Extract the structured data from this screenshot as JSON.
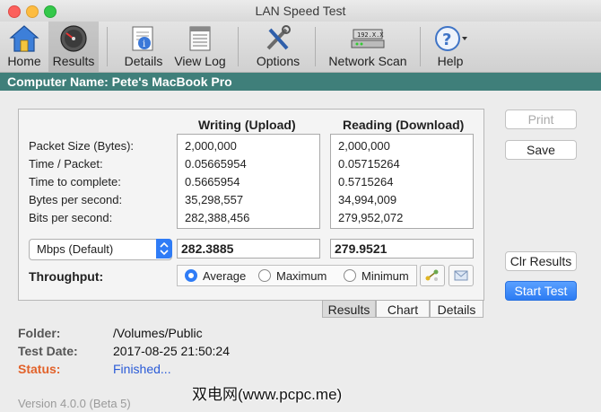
{
  "window": {
    "title": "LAN Speed Test"
  },
  "toolbar": {
    "home": "Home",
    "results": "Results",
    "details": "Details",
    "view_log": "View Log",
    "options": "Options",
    "network_scan": "Network Scan",
    "help": "Help"
  },
  "computer_bar": {
    "text": "Computer Name: Pete's MacBook Pro"
  },
  "results": {
    "writing_header": "Writing (Upload)",
    "reading_header": "Reading (Download)",
    "row_labels": [
      "Packet Size (Bytes):",
      "Time / Packet:",
      "Time to complete:",
      "Bytes per second:",
      "Bits per second:"
    ],
    "writing_values": [
      "2,000,000",
      "0.05665954",
      "0.5665954",
      "35,298,557",
      "282,388,456"
    ],
    "reading_values": [
      "2,000,000",
      "0.05715264",
      "0.5715264",
      "34,994,009",
      "279,952,072"
    ],
    "unit_select": "Mbps (Default)",
    "writing_throughput": "282.3885",
    "reading_throughput": "279.9521",
    "throughput_label": "Throughput:",
    "radio_average": "Average",
    "radio_maximum": "Maximum",
    "radio_minimum": "Minimum"
  },
  "tabs": {
    "results": "Results",
    "chart": "Chart",
    "details": "Details"
  },
  "side_buttons": {
    "print": "Print",
    "save": "Save",
    "clr_results": "Clr Results",
    "start_test": "Start Test"
  },
  "info": {
    "folder_label": "Folder:",
    "folder_value": "/Volumes/Public",
    "date_label": "Test Date:",
    "date_value": "2017-08-25 21:50:24",
    "status_label": "Status:",
    "status_value": "Finished..."
  },
  "version": "Version 4.0.0 (Beta 5)",
  "watermark": "双电网(www.pcpc.me)",
  "colors": {
    "accent": "#2f7cf6",
    "computer_bar": "#3f7f7a",
    "status_label": "#e2622a",
    "status_value": "#2a5bd7"
  }
}
